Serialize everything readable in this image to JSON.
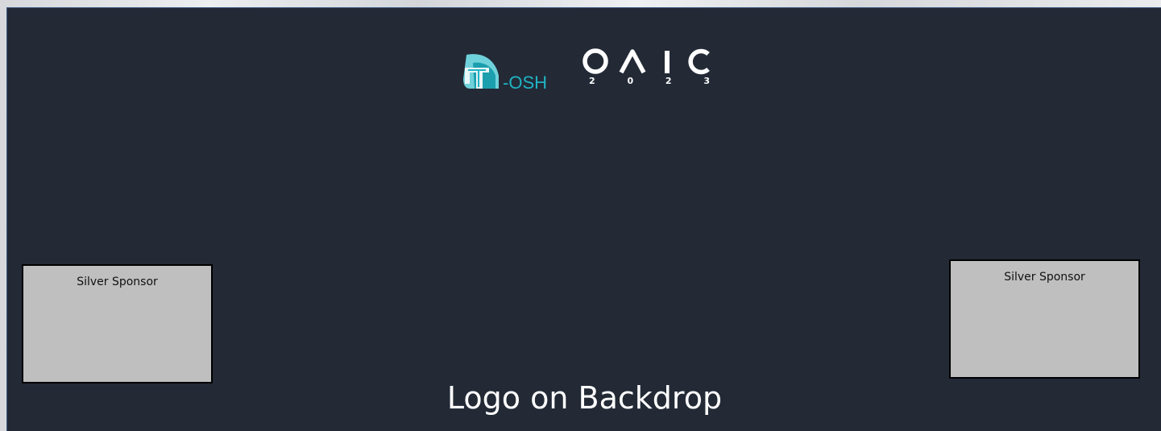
{
  "backdrop": {
    "caption": "Logo on Backdrop",
    "background_color": "#232a36"
  },
  "logos": {
    "tosh": {
      "text": "-OSH",
      "mark": "T",
      "color": "#1fb4c4"
    },
    "oaic": {
      "letters": "OAIC",
      "year_digits": [
        "2",
        "0",
        "2",
        "3"
      ],
      "color": "#ffffff"
    }
  },
  "sponsors": {
    "left": {
      "label": "Silver Sponsor"
    },
    "right": {
      "label": "Silver Sponsor"
    },
    "box_color": "#bfbfbf"
  }
}
